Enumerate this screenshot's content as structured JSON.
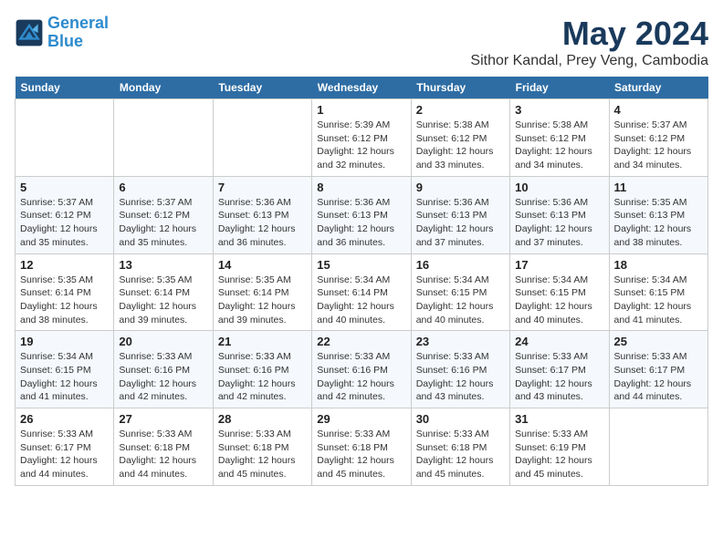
{
  "logo": {
    "line1": "General",
    "line2": "Blue"
  },
  "title": "May 2024",
  "location": "Sithor Kandal, Prey Veng, Cambodia",
  "weekdays": [
    "Sunday",
    "Monday",
    "Tuesday",
    "Wednesday",
    "Thursday",
    "Friday",
    "Saturday"
  ],
  "weeks": [
    [
      {
        "day": "",
        "info": ""
      },
      {
        "day": "",
        "info": ""
      },
      {
        "day": "",
        "info": ""
      },
      {
        "day": "1",
        "info": "Sunrise: 5:39 AM\nSunset: 6:12 PM\nDaylight: 12 hours\nand 32 minutes."
      },
      {
        "day": "2",
        "info": "Sunrise: 5:38 AM\nSunset: 6:12 PM\nDaylight: 12 hours\nand 33 minutes."
      },
      {
        "day": "3",
        "info": "Sunrise: 5:38 AM\nSunset: 6:12 PM\nDaylight: 12 hours\nand 34 minutes."
      },
      {
        "day": "4",
        "info": "Sunrise: 5:37 AM\nSunset: 6:12 PM\nDaylight: 12 hours\nand 34 minutes."
      }
    ],
    [
      {
        "day": "5",
        "info": "Sunrise: 5:37 AM\nSunset: 6:12 PM\nDaylight: 12 hours\nand 35 minutes."
      },
      {
        "day": "6",
        "info": "Sunrise: 5:37 AM\nSunset: 6:12 PM\nDaylight: 12 hours\nand 35 minutes."
      },
      {
        "day": "7",
        "info": "Sunrise: 5:36 AM\nSunset: 6:13 PM\nDaylight: 12 hours\nand 36 minutes."
      },
      {
        "day": "8",
        "info": "Sunrise: 5:36 AM\nSunset: 6:13 PM\nDaylight: 12 hours\nand 36 minutes."
      },
      {
        "day": "9",
        "info": "Sunrise: 5:36 AM\nSunset: 6:13 PM\nDaylight: 12 hours\nand 37 minutes."
      },
      {
        "day": "10",
        "info": "Sunrise: 5:36 AM\nSunset: 6:13 PM\nDaylight: 12 hours\nand 37 minutes."
      },
      {
        "day": "11",
        "info": "Sunrise: 5:35 AM\nSunset: 6:13 PM\nDaylight: 12 hours\nand 38 minutes."
      }
    ],
    [
      {
        "day": "12",
        "info": "Sunrise: 5:35 AM\nSunset: 6:14 PM\nDaylight: 12 hours\nand 38 minutes."
      },
      {
        "day": "13",
        "info": "Sunrise: 5:35 AM\nSunset: 6:14 PM\nDaylight: 12 hours\nand 39 minutes."
      },
      {
        "day": "14",
        "info": "Sunrise: 5:35 AM\nSunset: 6:14 PM\nDaylight: 12 hours\nand 39 minutes."
      },
      {
        "day": "15",
        "info": "Sunrise: 5:34 AM\nSunset: 6:14 PM\nDaylight: 12 hours\nand 40 minutes."
      },
      {
        "day": "16",
        "info": "Sunrise: 5:34 AM\nSunset: 6:15 PM\nDaylight: 12 hours\nand 40 minutes."
      },
      {
        "day": "17",
        "info": "Sunrise: 5:34 AM\nSunset: 6:15 PM\nDaylight: 12 hours\nand 40 minutes."
      },
      {
        "day": "18",
        "info": "Sunrise: 5:34 AM\nSunset: 6:15 PM\nDaylight: 12 hours\nand 41 minutes."
      }
    ],
    [
      {
        "day": "19",
        "info": "Sunrise: 5:34 AM\nSunset: 6:15 PM\nDaylight: 12 hours\nand 41 minutes."
      },
      {
        "day": "20",
        "info": "Sunrise: 5:33 AM\nSunset: 6:16 PM\nDaylight: 12 hours\nand 42 minutes."
      },
      {
        "day": "21",
        "info": "Sunrise: 5:33 AM\nSunset: 6:16 PM\nDaylight: 12 hours\nand 42 minutes."
      },
      {
        "day": "22",
        "info": "Sunrise: 5:33 AM\nSunset: 6:16 PM\nDaylight: 12 hours\nand 42 minutes."
      },
      {
        "day": "23",
        "info": "Sunrise: 5:33 AM\nSunset: 6:16 PM\nDaylight: 12 hours\nand 43 minutes."
      },
      {
        "day": "24",
        "info": "Sunrise: 5:33 AM\nSunset: 6:17 PM\nDaylight: 12 hours\nand 43 minutes."
      },
      {
        "day": "25",
        "info": "Sunrise: 5:33 AM\nSunset: 6:17 PM\nDaylight: 12 hours\nand 44 minutes."
      }
    ],
    [
      {
        "day": "26",
        "info": "Sunrise: 5:33 AM\nSunset: 6:17 PM\nDaylight: 12 hours\nand 44 minutes."
      },
      {
        "day": "27",
        "info": "Sunrise: 5:33 AM\nSunset: 6:18 PM\nDaylight: 12 hours\nand 44 minutes."
      },
      {
        "day": "28",
        "info": "Sunrise: 5:33 AM\nSunset: 6:18 PM\nDaylight: 12 hours\nand 45 minutes."
      },
      {
        "day": "29",
        "info": "Sunrise: 5:33 AM\nSunset: 6:18 PM\nDaylight: 12 hours\nand 45 minutes."
      },
      {
        "day": "30",
        "info": "Sunrise: 5:33 AM\nSunset: 6:18 PM\nDaylight: 12 hours\nand 45 minutes."
      },
      {
        "day": "31",
        "info": "Sunrise: 5:33 AM\nSunset: 6:19 PM\nDaylight: 12 hours\nand 45 minutes."
      },
      {
        "day": "",
        "info": ""
      }
    ]
  ]
}
